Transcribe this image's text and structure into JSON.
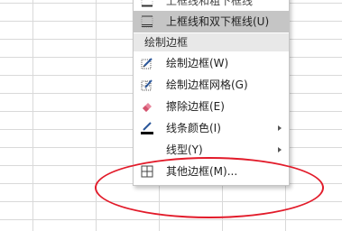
{
  "menu": {
    "items_top": [
      {
        "label": "上框线和粗下框线",
        "icon": "border-top-thick-bottom-icon"
      },
      {
        "label": "上框线和双下框线(U)",
        "icon": "border-top-double-bottom-icon"
      }
    ],
    "section_title": "绘制边框",
    "items": [
      {
        "label": "绘制边框(W)",
        "icon": "draw-border-icon"
      },
      {
        "label": "绘制边框网格(G)",
        "icon": "draw-border-grid-icon"
      },
      {
        "label": "擦除边框(E)",
        "icon": "eraser-icon"
      },
      {
        "label": "线条颜色(I)",
        "icon": "line-color-icon"
      },
      {
        "label": "线型(Y)",
        "icon": ""
      },
      {
        "label": "其他边框(M)...",
        "icon": "more-borders-icon"
      }
    ]
  },
  "colors": {
    "highlight": "#c5c5c5",
    "annotation": "#e21b2a",
    "accent_blue": "#2b579a"
  }
}
